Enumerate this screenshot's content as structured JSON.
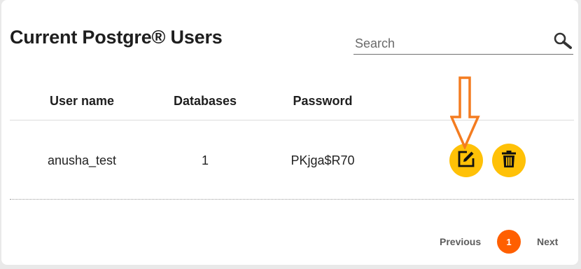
{
  "header": {
    "title": "Current Postgre® Users"
  },
  "search": {
    "placeholder": "Search",
    "value": "",
    "icon": "search-icon"
  },
  "table": {
    "columns": [
      "User name",
      "Databases",
      "Password"
    ],
    "rows": [
      {
        "user_name": "anusha_test",
        "databases": "1",
        "password": "PKjga$R70",
        "actions": [
          "edit-icon",
          "delete-icon"
        ]
      }
    ]
  },
  "pagination": {
    "previous_label": "Previous",
    "current_page": "1",
    "next_label": "Next"
  },
  "colors": {
    "action_button": "#ffc107",
    "current_page": "#ff5f00",
    "annotation_arrow": "#f47c20"
  }
}
